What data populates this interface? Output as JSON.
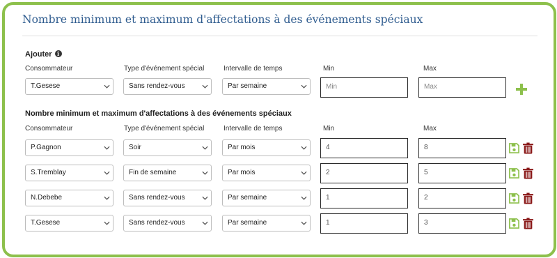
{
  "title": "Nombre minimum et maximum d'affectations à des événements spéciaux",
  "add_section": {
    "label": "Ajouter",
    "columns": {
      "consumer": "Consommateur",
      "event_type": "Type d'événement spécial",
      "interval": "Intervalle de temps",
      "min": "Min",
      "max": "Max"
    },
    "consumer": "T.Gesese",
    "event_type": "Sans rendez-vous",
    "interval": "Par semaine",
    "min_placeholder": "Min",
    "max_placeholder": "Max"
  },
  "list_section": {
    "label": "Nombre minimum et maximum d'affectations à des événements spéciaux",
    "columns": {
      "consumer": "Consommateur",
      "event_type": "Type d'événement spécial",
      "interval": "Intervalle de temps",
      "min": "Min",
      "max": "Max"
    },
    "rows": [
      {
        "consumer": "P.Gagnon",
        "event_type": "Soir",
        "interval": "Par mois",
        "min": "4",
        "max": "8"
      },
      {
        "consumer": "S.Tremblay",
        "event_type": "Fin de semaine",
        "interval": "Par mois",
        "min": "2",
        "max": "5"
      },
      {
        "consumer": "N.Debebe",
        "event_type": "Sans rendez-vous",
        "interval": "Par semaine",
        "min": "1",
        "max": "2"
      },
      {
        "consumer": "T.Gesese",
        "event_type": "Sans rendez-vous",
        "interval": "Par semaine",
        "min": "1",
        "max": "3"
      }
    ]
  },
  "icons": {
    "info": "info-circle-icon",
    "add": "plus-icon",
    "save": "floppy-disk-icon",
    "delete": "trash-icon",
    "dropdown": "chevron-down-icon"
  },
  "colors": {
    "accent_green": "#8dc04c",
    "title_blue": "#2f5c8f",
    "delete_red": "#8b1a1a"
  }
}
